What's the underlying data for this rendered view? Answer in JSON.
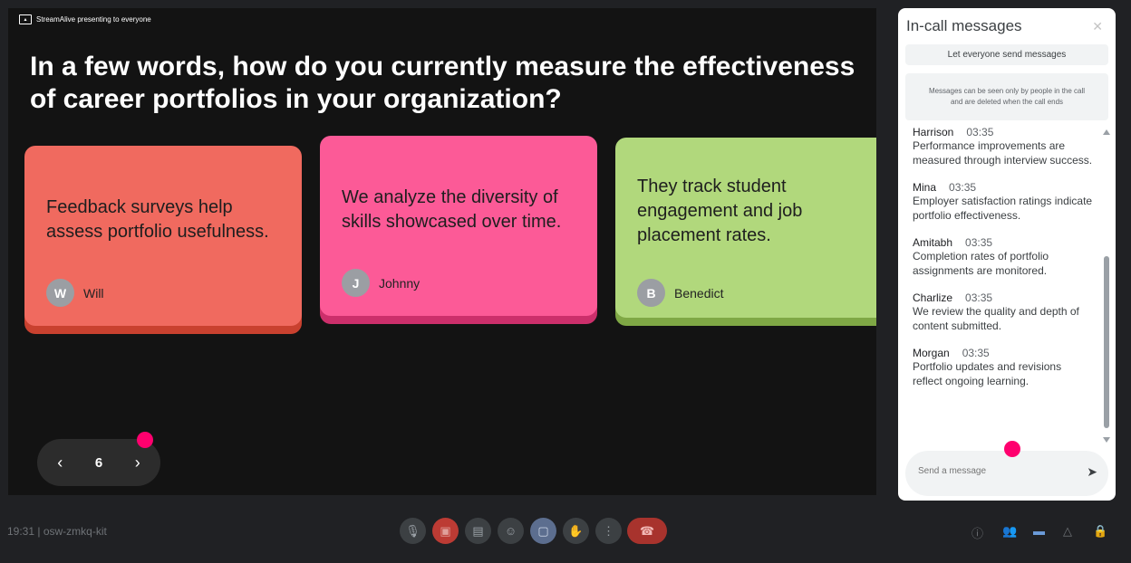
{
  "presenter": {
    "label": "StreamAlive presenting to everyone",
    "icon": "present-screen-icon"
  },
  "question": "In a few words, how do you currently measure the effectiveness of career portfolios in your organization?",
  "cards": [
    {
      "text": "Feedback surveys help assess portfolio usefulness.",
      "initial": "W",
      "name": "Will",
      "color": "#f06a5f"
    },
    {
      "text": "We analyze the diversity of skills showcased over time.",
      "initial": "J",
      "name": "Johnny",
      "color": "#fc5a97"
    },
    {
      "text": "They track student engagement and job placement rates.",
      "initial": "B",
      "name": "Benedict",
      "color": "#b1d87c"
    }
  ],
  "pager": {
    "page": "6",
    "prev_icon": "chevron-left-icon",
    "next_icon": "chevron-right-icon"
  },
  "panel": {
    "title": "In-call messages",
    "close_icon": "close-icon",
    "toggle_label": "Let everyone send messages",
    "notice": "Messages can be seen only by people in the call and are deleted when the call ends",
    "messages": [
      {
        "name": "Harrison",
        "time": "03:35",
        "text": "Performance improvements are measured through interview success."
      },
      {
        "name": "Mina",
        "time": "03:35",
        "text": "Employer satisfaction ratings indicate portfolio effectiveness."
      },
      {
        "name": "Amitabh",
        "time": "03:35",
        "text": "Completion rates of portfolio assignments are monitored."
      },
      {
        "name": "Charlize",
        "time": "03:35",
        "text": "We review the quality and depth of content submitted."
      },
      {
        "name": "Morgan",
        "time": "03:35",
        "text": "Portfolio updates and revisions reflect ongoing learning."
      }
    ],
    "input_placeholder": "Send a message",
    "send_icon": "send-icon"
  },
  "footer": {
    "meeting_info": "19:31 | osw-zmkq-kit",
    "controls": [
      "mic-icon",
      "camera-off-icon",
      "captions-icon",
      "emoji-icon",
      "present-icon",
      "raise-hand-icon",
      "more-options-icon",
      "end-call-icon"
    ],
    "right_icons": [
      "info-icon",
      "people-icon",
      "chat-icon",
      "activities-icon",
      "host-controls-icon"
    ]
  }
}
